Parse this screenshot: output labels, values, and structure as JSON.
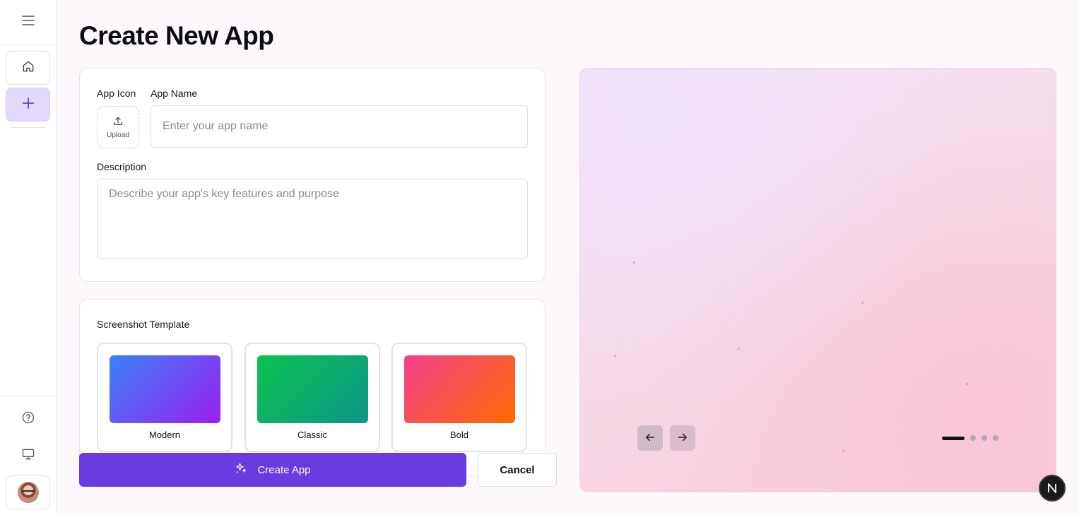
{
  "page": {
    "title": "Create New App"
  },
  "sidebar": {
    "items": [
      {
        "name": "menu",
        "icon": "hamburger-icon"
      },
      {
        "name": "home",
        "icon": "home-icon"
      },
      {
        "name": "create",
        "icon": "plus-icon",
        "active": true
      },
      {
        "name": "help",
        "icon": "help-circle-icon"
      },
      {
        "name": "display",
        "icon": "monitor-icon"
      },
      {
        "name": "profile",
        "icon": "avatar"
      }
    ]
  },
  "form": {
    "app_icon_label": "App Icon",
    "upload_label": "Upload",
    "app_name_label": "App Name",
    "app_name_placeholder": "Enter your app name",
    "app_name_value": "",
    "description_label": "Description",
    "description_placeholder": "Describe your app's key features and purpose",
    "description_value": ""
  },
  "templates": {
    "label": "Screenshot Template",
    "items": [
      {
        "name": "Modern",
        "gradient": [
          "#3b82f6",
          "#9b1ff0"
        ]
      },
      {
        "name": "Classic",
        "gradient": [
          "#0bc44f",
          "#0d9488"
        ]
      },
      {
        "name": "Bold",
        "gradient": [
          "#f43f8e",
          "#ff6a00"
        ]
      }
    ]
  },
  "actions": {
    "create_label": "Create App",
    "cancel_label": "Cancel"
  },
  "preview": {
    "active_slide": 1,
    "slide_count": 4
  },
  "badge": {
    "letter": "N"
  },
  "colors": {
    "accent": "#6a3be0",
    "sidebar_active_bg": "#e3d9fb"
  }
}
